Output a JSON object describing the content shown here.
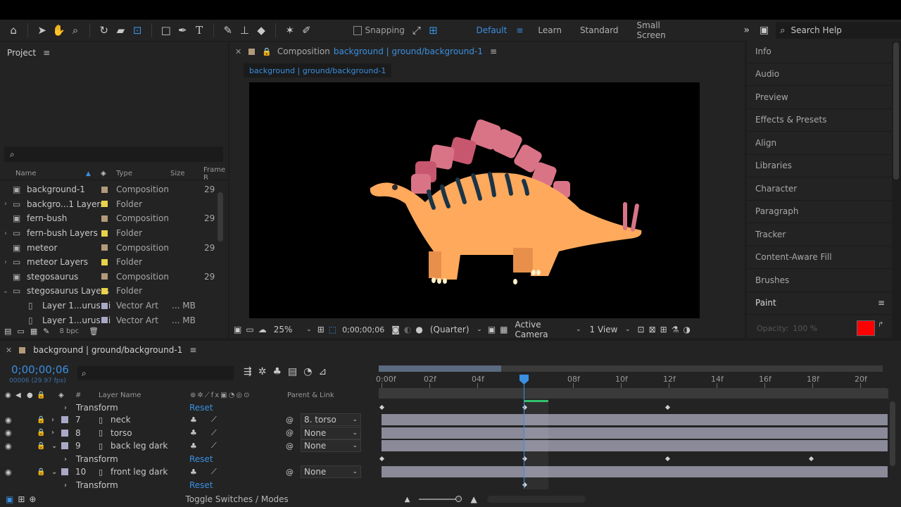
{
  "toolbar": {
    "snapping_label": "Snapping",
    "workspaces": [
      "Default",
      "Learn",
      "Standard",
      "Small Screen"
    ],
    "active_workspace": "Default",
    "search_placeholder": "Search Help"
  },
  "project": {
    "title": "Project",
    "columns": [
      "Name",
      "Type",
      "Size",
      "Frame R"
    ],
    "items": [
      {
        "name": "background-1",
        "type": "Composition",
        "size": "",
        "frame": "29.",
        "color": "#b29a7a",
        "kind": "comp"
      },
      {
        "name": "backgro...1 Layers",
        "type": "Folder",
        "size": "",
        "frame": "",
        "color": "#e8d24a",
        "kind": "folder"
      },
      {
        "name": "fern-bush",
        "type": "Composition",
        "size": "",
        "frame": "29.",
        "color": "#b29a7a",
        "kind": "comp"
      },
      {
        "name": "fern-bush Layers",
        "type": "Folder",
        "size": "",
        "frame": "",
        "color": "#e8d24a",
        "kind": "folder"
      },
      {
        "name": "meteor",
        "type": "Composition",
        "size": "",
        "frame": "29.",
        "color": "#b29a7a",
        "kind": "comp"
      },
      {
        "name": "meteor Layers",
        "type": "Folder",
        "size": "",
        "frame": "",
        "color": "#e8d24a",
        "kind": "folder"
      },
      {
        "name": "stegosaurus",
        "type": "Composition",
        "size": "",
        "frame": "29.",
        "color": "#b29a7a",
        "kind": "comp"
      },
      {
        "name": "stegosaurus Layers",
        "type": "Folder",
        "size": "",
        "frame": "",
        "color": "#e8d24a",
        "kind": "folder"
      },
      {
        "name": "Layer 1...urus.ai",
        "type": "Vector Art",
        "size": "... MB",
        "frame": "",
        "color": "#a8a8c8",
        "kind": "file"
      },
      {
        "name": "Layer 1...urus.ai",
        "type": "Vector Art",
        "size": "... MB",
        "frame": "",
        "color": "#a8a8c8",
        "kind": "file"
      }
    ],
    "bpc": "8 bpc"
  },
  "composition": {
    "tab_label": "Composition",
    "tab_name": "background | ground/background-1",
    "breadcrumb": "background | ground/background-1",
    "zoom": "25%",
    "timecode": "0;00;00;06",
    "resolution": "(Quarter)",
    "camera": "Active Camera",
    "view": "1 View"
  },
  "right_panel": {
    "items": [
      "Info",
      "Audio",
      "Preview",
      "Effects & Presets",
      "Align",
      "Libraries",
      "Character",
      "Paragraph",
      "Tracker",
      "Content-Aware Fill",
      "Brushes",
      "Paint"
    ],
    "opacity_label": "Opacity:",
    "opacity_value": "100 %",
    "paint_color": "#ff0000"
  },
  "timeline": {
    "tab_name": "background | ground/background-1",
    "timecode": "0;00;00;06",
    "fps": "00006 (29.97 fps)",
    "col_hash": "#",
    "col_layer_name": "Layer Name",
    "col_parent": "Parent & Link",
    "ticks": [
      "0:00f",
      "02f",
      "04f",
      "08f",
      "10f",
      "12f",
      "14f",
      "16f",
      "18f",
      "20f"
    ],
    "rows": [
      {
        "kind": "transform",
        "label": "Transform",
        "reset": "Reset"
      },
      {
        "kind": "layer",
        "num": "7",
        "name": "neck",
        "parent": "8. torso",
        "expanded": false
      },
      {
        "kind": "layer",
        "num": "8",
        "name": "torso",
        "parent": "None",
        "expanded": false
      },
      {
        "kind": "layer",
        "num": "9",
        "name": "back leg dark",
        "parent": "None",
        "expanded": true
      },
      {
        "kind": "transform",
        "label": "Transform",
        "reset": "Reset"
      },
      {
        "kind": "layer",
        "num": "10",
        "name": "front leg dark",
        "parent": "None",
        "expanded": true
      },
      {
        "kind": "transform",
        "label": "Transform",
        "reset": "Reset"
      }
    ],
    "footer": "Toggle Switches / Modes"
  }
}
